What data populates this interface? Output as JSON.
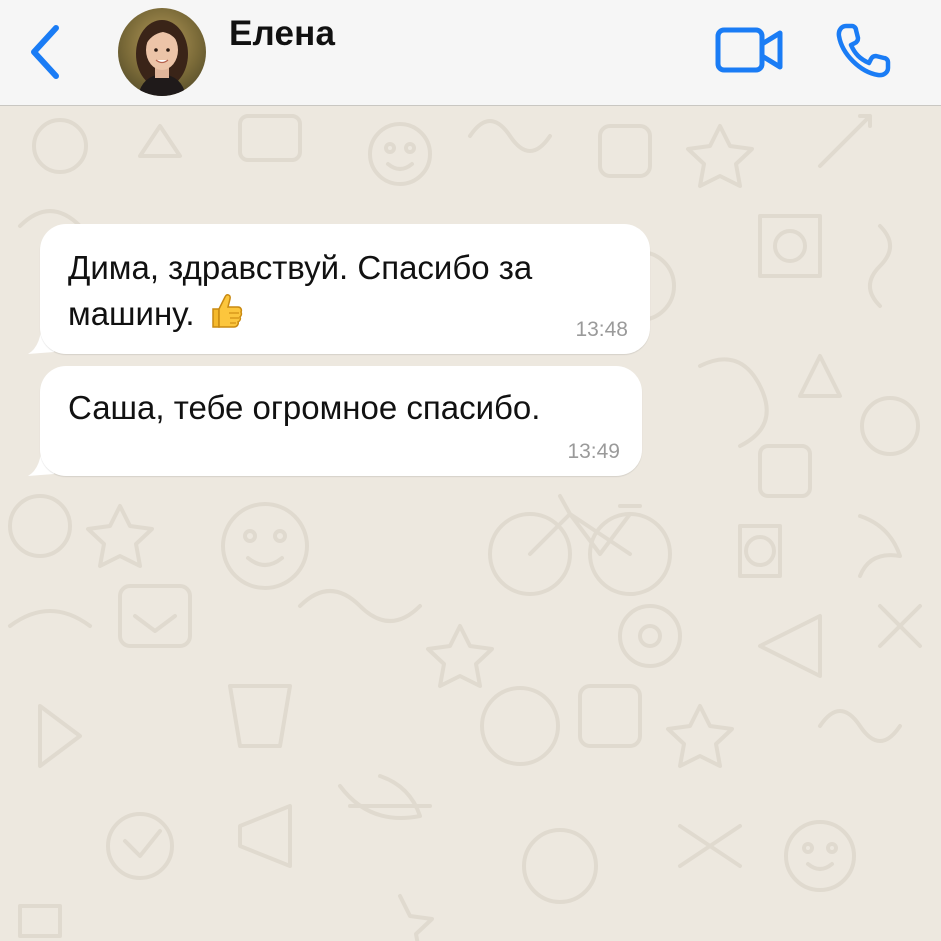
{
  "header": {
    "back_icon": "chevron-left-icon",
    "contact_name": "Елена",
    "avatar_icon": "contact-avatar",
    "video_icon": "video-camera-icon",
    "call_icon": "phone-icon",
    "accent_color": "#1a7cf5",
    "background_color": "#f6f6f6"
  },
  "chat": {
    "wallpaper_color": "#ede8df",
    "messages": [
      {
        "direction": "incoming",
        "text": "Дима, здравствуй. Спасибо за\nмашину.",
        "emoji_icon": "thumbs-up-emoji",
        "time": "13:48"
      },
      {
        "direction": "incoming",
        "text": "Саша, тебе огромное спасибо.",
        "time": "13:49"
      }
    ]
  }
}
